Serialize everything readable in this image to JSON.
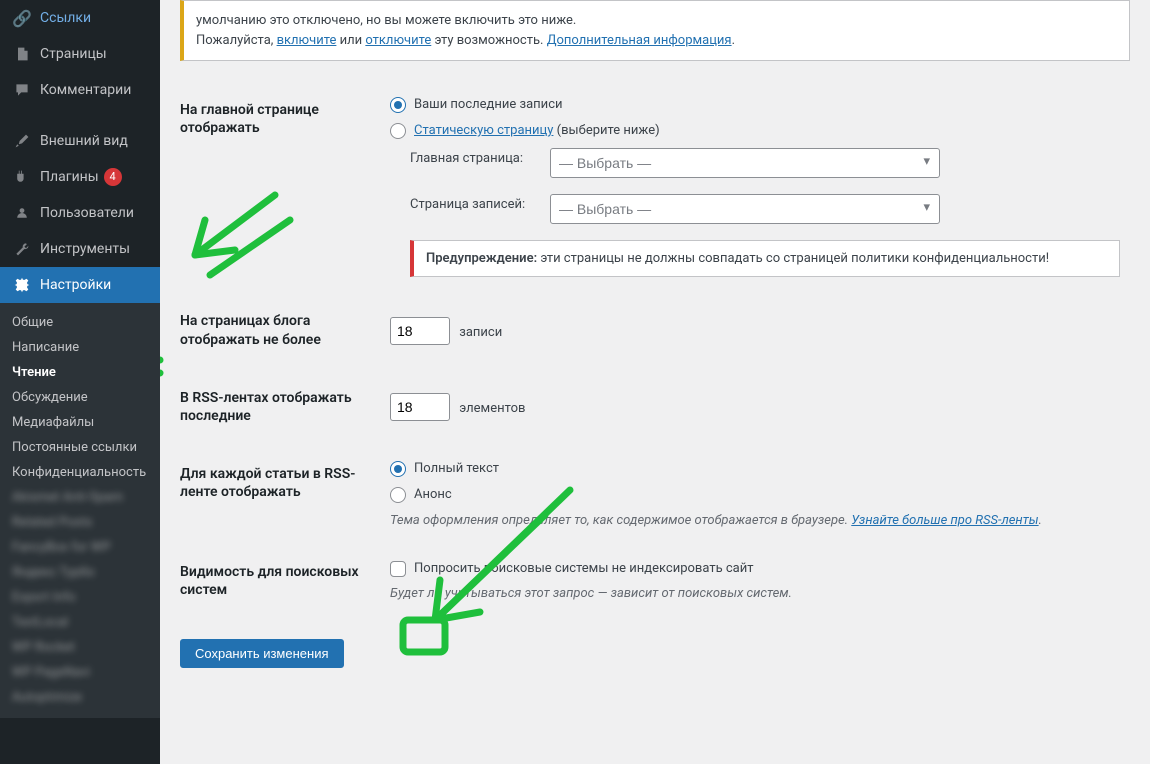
{
  "sidebar": {
    "items": [
      {
        "label": "Ссылки"
      },
      {
        "label": "Страницы"
      },
      {
        "label": "Комментарии"
      },
      {
        "label": "Внешний вид"
      },
      {
        "label": "Плагины",
        "count": "4"
      },
      {
        "label": "Пользователи"
      },
      {
        "label": "Инструменты"
      },
      {
        "label": "Настройки"
      }
    ],
    "submenu": [
      "Общие",
      "Написание",
      "Чтение",
      "Обсуждение",
      "Медиафайлы",
      "Постоянные ссылки",
      "Конфиденциальность"
    ]
  },
  "notice": {
    "line1_prefix": "умолчанию это отключено, но вы можете включить это ниже.",
    "line2_prefix": "Пожалуйста, ",
    "enable": "включите",
    "or": " или ",
    "disable": "отключите",
    "suffix": " эту возможность. ",
    "more": "Дополнительная информация",
    "dot": "."
  },
  "front": {
    "label": "На главной странице отображать",
    "opt_posts": "Ваши последние записи",
    "opt_static": "Статическую страницу",
    "opt_static_suffix": " (выберите ниже)",
    "home_label": "Главная страница:",
    "posts_label": "Страница записей:",
    "select_placeholder": "— Выбрать —",
    "warning_strong": "Предупреждение:",
    "warning_text": " эти страницы не должны совпадать со страницей политики конфиденциальности!"
  },
  "blog_pages": {
    "label": "На страницах блога отображать не более",
    "value": "18",
    "after": "записи"
  },
  "rss_count": {
    "label": "В RSS-лентах отображать последние",
    "value": "18",
    "after": "элементов"
  },
  "rss_each": {
    "label": "Для каждой статьи в RSS-ленте отображать",
    "full": "Полный текст",
    "summary": "Анонс",
    "desc_prefix": "Тема оформления определяет то, как содержимое отображается в браузере. ",
    "desc_link": "Узнайте больше про RSS-ленты",
    "desc_dot": "."
  },
  "visibility": {
    "label": "Видимость для поисковых систем",
    "checkbox_label": "Попросить поисковые системы не индексировать сайт",
    "desc": "Будет ли учитываться этот запрос — зависит от поисковых систем."
  },
  "submit": "Сохранить изменения"
}
